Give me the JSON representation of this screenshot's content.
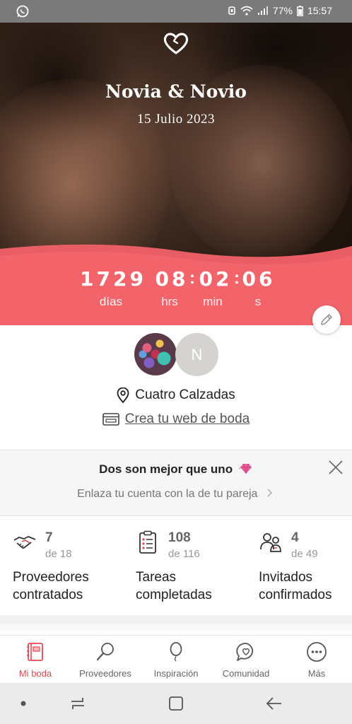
{
  "status_bar": {
    "battery": "77%",
    "time": "15:57",
    "icons": [
      "whatsapp-icon",
      "alarm-icon",
      "wifi-icon",
      "signal-icon",
      "battery-icon"
    ]
  },
  "hero": {
    "logo_icon": "heart-logo-icon",
    "couple": "Novia & Novio",
    "date": "15 Julio 2023",
    "accent_color": "#f2646a"
  },
  "countdown": {
    "days": "1729",
    "hours": "08",
    "minutes": "02",
    "seconds": "06",
    "days_label": "días",
    "hours_label": "hrs",
    "minutes_label": "min",
    "seconds_label": "s",
    "separator": ":"
  },
  "profile": {
    "partner_initial": "N",
    "location": "Cuatro Calzadas",
    "web_link": "Crea tu web de boda"
  },
  "promo": {
    "title": "Dos son mejor que uno",
    "subtitle": "Enlaza tu cuenta con la de tu pareja"
  },
  "stats": [
    {
      "icon": "handshake-icon",
      "value": "7",
      "total": "de 18",
      "label_line1": "Proveedores",
      "label_line2": "contratados"
    },
    {
      "icon": "checklist-icon",
      "value": "108",
      "total": "de 116",
      "label_line1": "Tareas",
      "label_line2": "completadas"
    },
    {
      "icon": "guests-icon",
      "value": "4",
      "total": "de 49",
      "label_line1": "Invitados",
      "label_line2": "confirmados"
    }
  ],
  "bottom_nav": [
    {
      "label": "Mi boda",
      "icon": "notebook-icon",
      "active": true
    },
    {
      "label": "Proveedores",
      "icon": "search-icon",
      "active": false
    },
    {
      "label": "Inspiración",
      "icon": "balloon-icon",
      "active": false
    },
    {
      "label": "Comunidad",
      "icon": "chat-heart-icon",
      "active": false
    },
    {
      "label": "Más",
      "icon": "more-icon",
      "active": false
    }
  ],
  "colors": {
    "brand": "#f2646a",
    "active_nav": "#e4494f"
  }
}
